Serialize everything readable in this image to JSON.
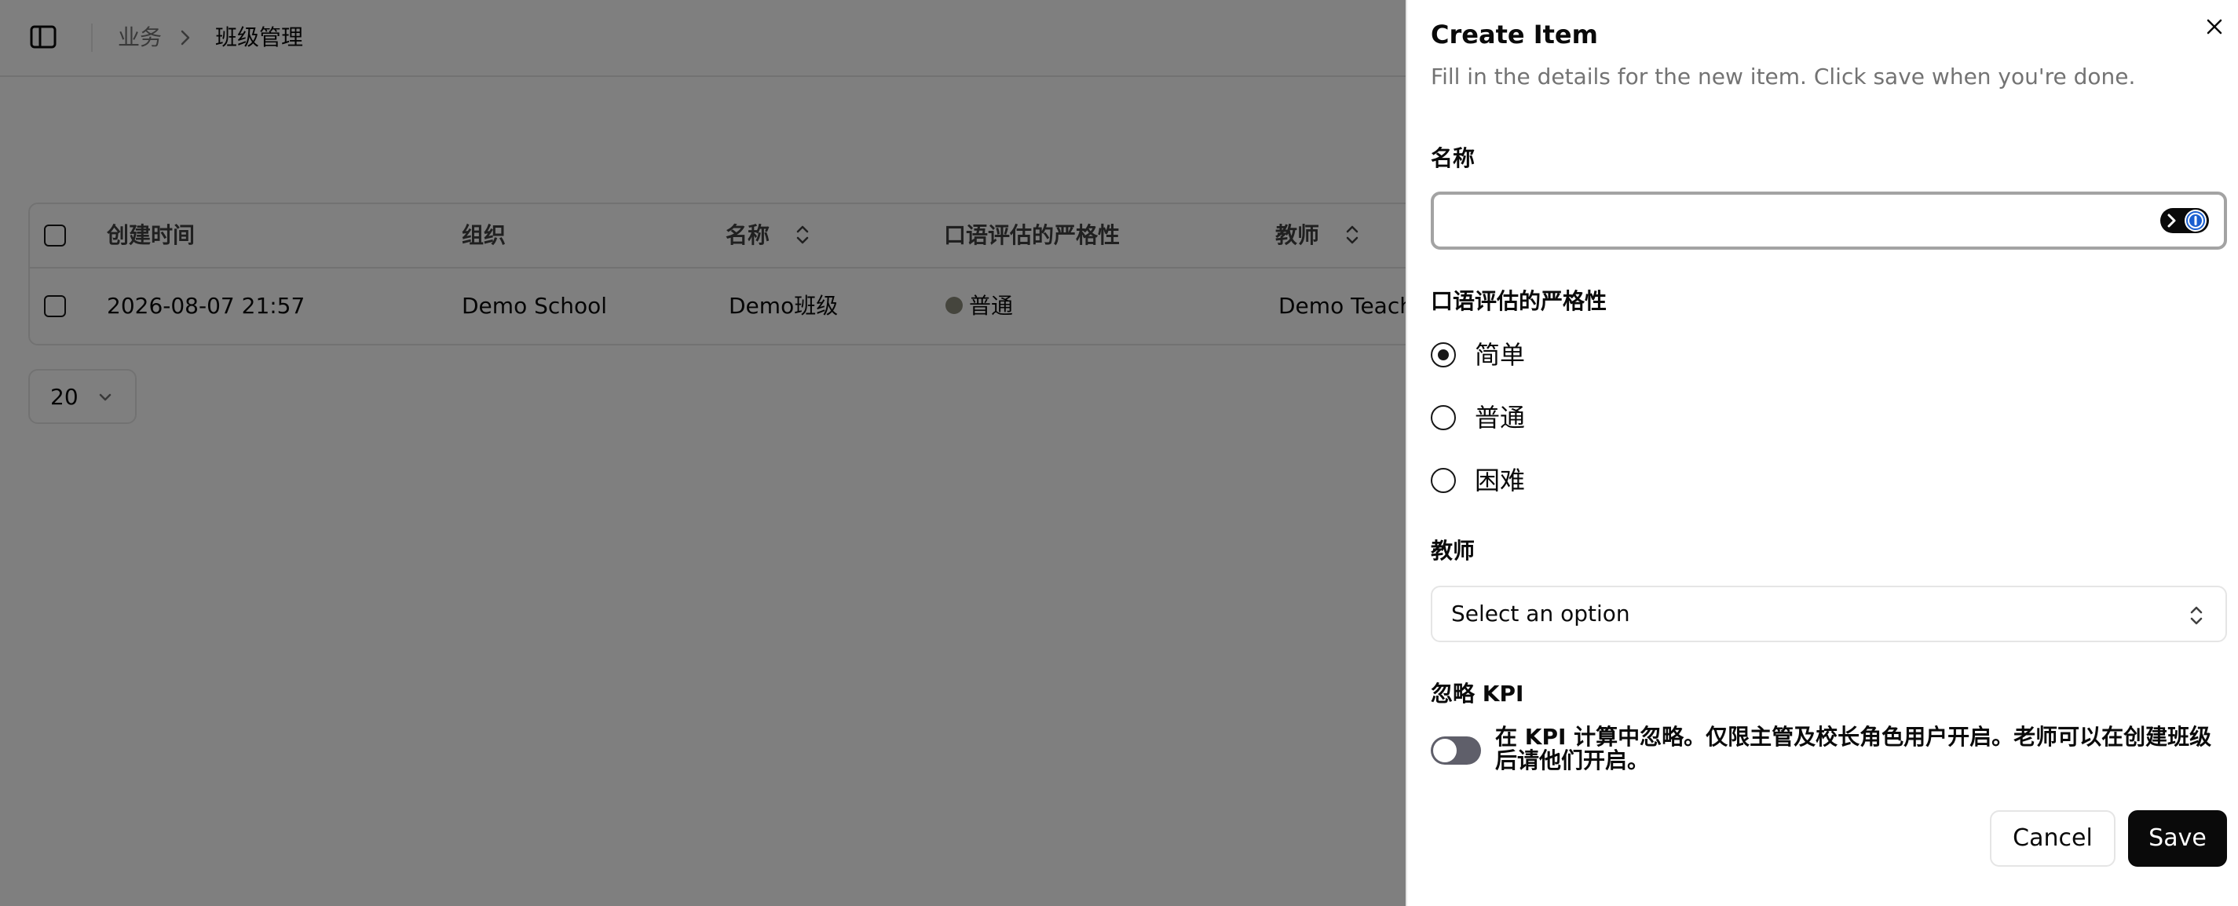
{
  "breadcrumb": {
    "section": "业务",
    "page": "班级管理"
  },
  "table": {
    "headers": {
      "created_at": "创建时间",
      "organization": "组织",
      "name": "名称",
      "strictness": "口语评估的严格性",
      "teacher": "教师"
    },
    "rows": [
      {
        "created_at": "2026-08-07 21:57",
        "organization": "Demo School",
        "name": "Demo班级",
        "strictness": "普通",
        "teacher": "Demo Teach"
      }
    ]
  },
  "pagination": {
    "page_size": "20"
  },
  "sheet": {
    "title": "Create Item",
    "description": "Fill in the details for the new item. Click save when you're done.",
    "name_label": "名称",
    "name_value": "",
    "strictness_label": "口语评估的严格性",
    "strictness_options": [
      {
        "label": "简单",
        "checked": true
      },
      {
        "label": "普通",
        "checked": false
      },
      {
        "label": "困难",
        "checked": false
      }
    ],
    "teacher_label": "教师",
    "teacher_placeholder": "Select an option",
    "kpi_label": "忽略 KPI",
    "kpi_description": "在 KPI 计算中忽略。仅限主管及校长角色用户开启。老师可以在创建班级后请他们开启。",
    "kpi_enabled": false,
    "cancel_label": "Cancel",
    "save_label": "Save"
  },
  "colors": {
    "overlay": "#000000",
    "primary": "#0a0a0a",
    "muted_text": "#737373",
    "border": "#e5e5e5",
    "status_dot": "#8a8a7a",
    "switch_off": "#5f5f6a"
  },
  "icons": [
    "sidebar-toggle-icon",
    "chevron-right-icon",
    "sort-icon",
    "chevron-down-icon",
    "close-icon",
    "password-manager-icon",
    "chevrons-up-down-icon"
  ]
}
